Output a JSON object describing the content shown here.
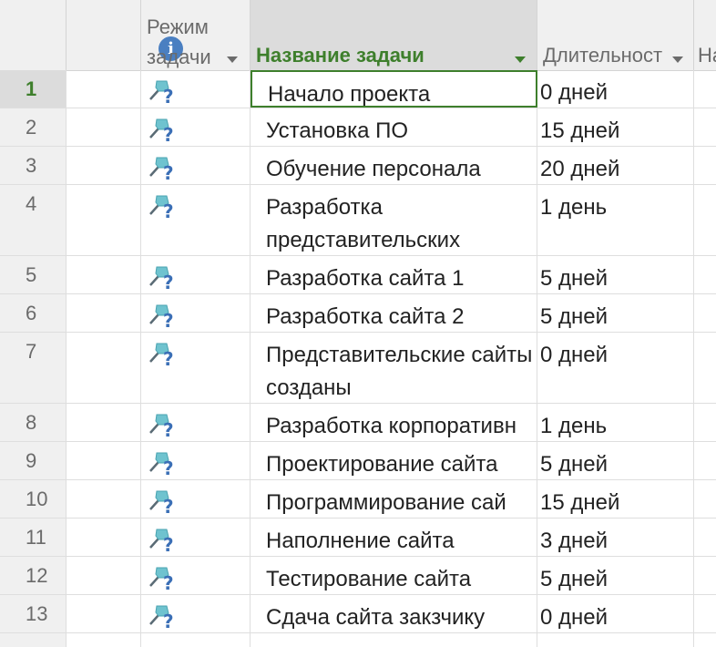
{
  "header": {
    "info_icon": "i",
    "mode_line1": "Режим",
    "mode_line2": "задачи",
    "name": "Название задачи",
    "duration": "Длительност",
    "next": "На"
  },
  "icons": {
    "info": "info-icon",
    "task_mode": "manual-task-pin-question-icon",
    "sort": "dropdown-arrow-icon"
  },
  "colors": {
    "accent": "#3e7f2c",
    "info": "#4a7fc1",
    "pin": "#6fc3cf"
  },
  "rows": [
    {
      "id": "1",
      "name": "Начало проекта",
      "duration": "0 дней"
    },
    {
      "id": "2",
      "name": "Установка ПО",
      "duration": "15 дней"
    },
    {
      "id": "3",
      "name": "Обучение персонала",
      "duration": "20 дней"
    },
    {
      "id": "4",
      "name": "Разработка представительских",
      "duration": "1 день"
    },
    {
      "id": "5",
      "name": "Разработка сайта 1",
      "duration": "5 дней"
    },
    {
      "id": "6",
      "name": "Разработка сайта 2",
      "duration": "5 дней"
    },
    {
      "id": "7",
      "name": "Представительские сайты созданы",
      "duration": "0 дней"
    },
    {
      "id": "8",
      "name": "Разработка корпоративн",
      "duration": "1 день"
    },
    {
      "id": "9",
      "name": "Проектирование сайта",
      "duration": "5 дней"
    },
    {
      "id": "10",
      "name": "Программирование сай",
      "duration": "15 дней"
    },
    {
      "id": "11",
      "name": "Наполнение сайта",
      "duration": "3 дней"
    },
    {
      "id": "12",
      "name": "Тестирование сайта",
      "duration": "5 дней"
    },
    {
      "id": "13",
      "name": "Сдача сайта закзчику",
      "duration": "0 дней"
    }
  ]
}
